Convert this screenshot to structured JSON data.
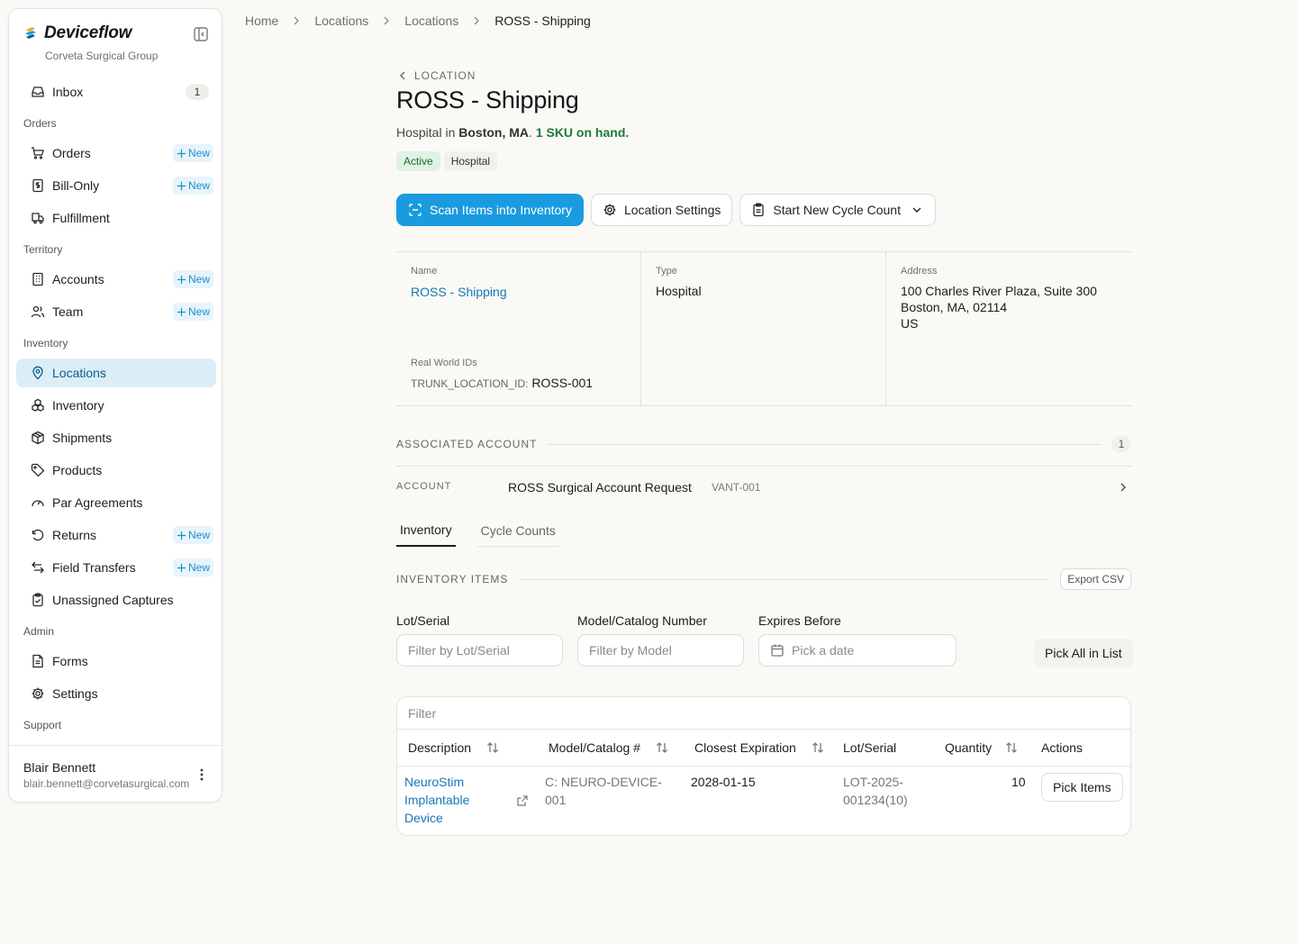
{
  "app": {
    "name": "Deviceflow",
    "org": "Corveta Surgical Group"
  },
  "sidebar": {
    "inbox": {
      "label": "Inbox",
      "badge": "1"
    },
    "new_label": "New",
    "sections": {
      "orders": "Orders",
      "territory": "Territory",
      "inventory": "Inventory",
      "admin": "Admin",
      "support": "Support"
    },
    "items": {
      "orders": "Orders",
      "bill_only": "Bill-Only",
      "fulfillment": "Fulfillment",
      "accounts": "Accounts",
      "team": "Team",
      "locations": "Locations",
      "inventory": "Inventory",
      "shipments": "Shipments",
      "products": "Products",
      "par_agreements": "Par Agreements",
      "returns": "Returns",
      "field_transfers": "Field Transfers",
      "unassigned_captures": "Unassigned Captures",
      "forms": "Forms",
      "settings": "Settings"
    },
    "user": {
      "name": "Blair Bennett",
      "email": "blair.bennett@corvetasurgical.com"
    }
  },
  "breadcrumbs": [
    "Home",
    "Locations",
    "Locations",
    "ROSS - Shipping"
  ],
  "header": {
    "back_label": "LOCATION",
    "title": "ROSS - Shipping",
    "subtitle_prefix": "Hospital in",
    "subtitle_city": "Boston, MA",
    "subtitle_sep": ".",
    "subtitle_sku": "1 SKU on hand.",
    "tags": {
      "status": "Active",
      "type": "Hospital"
    }
  },
  "actions": {
    "scan": "Scan Items into Inventory",
    "settings": "Location Settings",
    "cycle_count": "Start New Cycle Count"
  },
  "details": {
    "name_label": "Name",
    "name_value": "ROSS - Shipping",
    "type_label": "Type",
    "type_value": "Hospital",
    "address_label": "Address",
    "address_line1": "100 Charles River Plaza, Suite 300",
    "address_line2": "Boston, MA, 02114",
    "address_line3": "US",
    "rwid_label": "Real World IDs",
    "rwid_key": "TRUNK_LOCATION_ID:",
    "rwid_value": "ROSS-001"
  },
  "associated_account": {
    "title": "ASSOCIATED ACCOUNT",
    "count": "1",
    "row_label": "ACCOUNT",
    "account_name": "ROSS Surgical Account Request",
    "account_code": "VANT-001"
  },
  "tabs": {
    "inventory": "Inventory",
    "cycle_counts": "Cycle Counts"
  },
  "inventory_items": {
    "title": "INVENTORY ITEMS",
    "export": "Export CSV",
    "filters": {
      "lot_label": "Lot/Serial",
      "lot_placeholder": "Filter by Lot/Serial",
      "model_label": "Model/Catalog Number",
      "model_placeholder": "Filter by Model",
      "expires_label": "Expires Before",
      "date_placeholder": "Pick a date"
    },
    "pick_all": "Pick All in List",
    "table_filter_placeholder": "Filter",
    "columns": {
      "description": "Description",
      "model": "Model/Catalog #",
      "expiration": "Closest Expiration",
      "lot": "Lot/Serial",
      "quantity": "Quantity",
      "actions": "Actions"
    },
    "rows": [
      {
        "description_l1": "NeuroStim",
        "description_l2": "Implantable",
        "description_l3": "Device",
        "model_l1": "C: NEURO-DEVICE-",
        "model_l2": "001",
        "expiration": "2028-01-15",
        "lot_l1": "LOT-2025-",
        "lot_l2": "001234(10)",
        "quantity": "10",
        "action": "Pick Items"
      }
    ]
  },
  "colors": {
    "primary": "#1a9be0",
    "link": "#1677b8",
    "active_nav_bg": "#dbeef8",
    "success": "#1f7a3a"
  }
}
